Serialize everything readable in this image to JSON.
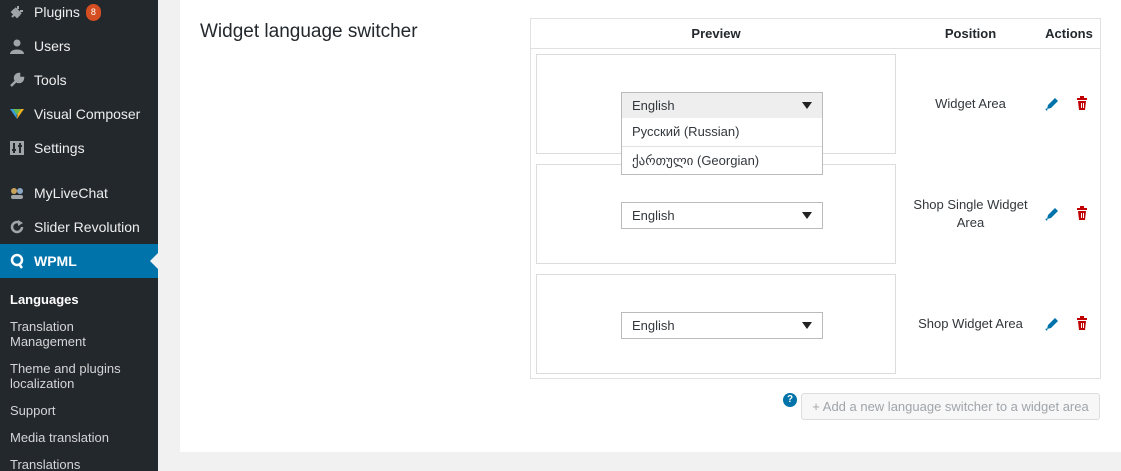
{
  "sidebar": {
    "menu": [
      {
        "label": "Plugins",
        "icon": "plug-icon",
        "badge": "8"
      },
      {
        "label": "Users",
        "icon": "users-icon"
      },
      {
        "label": "Tools",
        "icon": "wrench-icon"
      },
      {
        "label": "Visual Composer",
        "icon": "visual-composer-icon"
      },
      {
        "label": "Settings",
        "icon": "settings-icon"
      },
      {
        "label": "MyLiveChat",
        "icon": "chat-icon"
      },
      {
        "label": "Slider Revolution",
        "icon": "refresh-icon"
      },
      {
        "label": "WPML",
        "icon": "wpml-icon"
      }
    ],
    "submenu": [
      {
        "label": "Languages"
      },
      {
        "label": "Translation Management"
      },
      {
        "label": "Theme and plugins localization"
      },
      {
        "label": "Support"
      },
      {
        "label": "Media translation"
      },
      {
        "label": "Translations"
      }
    ]
  },
  "section": {
    "title": "Widget language switcher"
  },
  "table": {
    "headers": {
      "preview": "Preview",
      "position": "Position",
      "actions": "Actions"
    },
    "rows": [
      {
        "selected": "English",
        "position": "Widget Area",
        "dropdown_open": true,
        "options": [
          "Русский (Russian)",
          "ქართული (Georgian)"
        ]
      },
      {
        "selected": "English",
        "position": "Shop Single Widget Area"
      },
      {
        "selected": "English",
        "position": "Shop Widget Area"
      }
    ]
  },
  "add_button": {
    "label": "+ Add a new language switcher to a widget area"
  },
  "help_icon": {
    "symbol": "?"
  },
  "colors": {
    "sidebar_bg": "#23282d",
    "active_menu": "#0073aa",
    "plugins_badge": "#d54e21",
    "edit_icon": "#0073aa",
    "delete_icon": "#c00000"
  }
}
